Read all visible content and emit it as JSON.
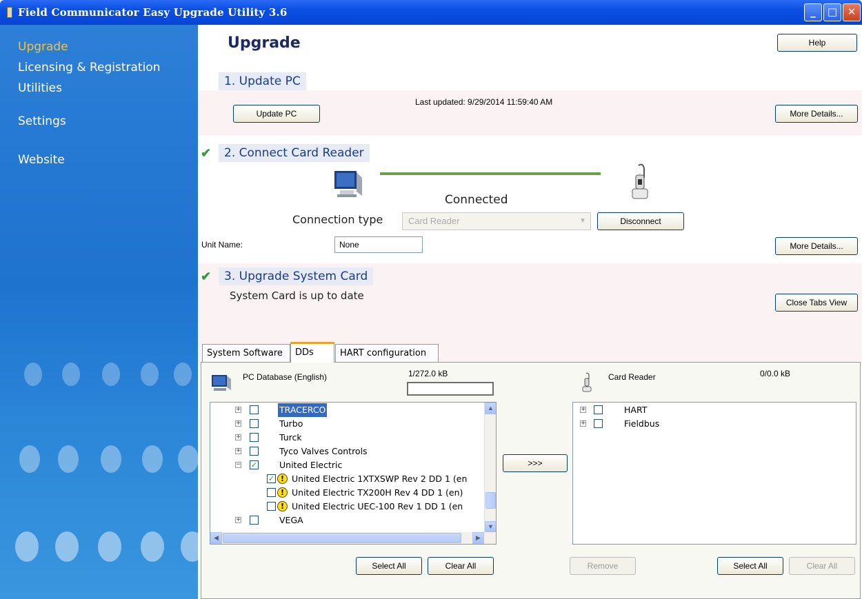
{
  "window": {
    "title": "Field Communicator Easy Upgrade Utility 3.6",
    "controls": {
      "minimize": "_",
      "maximize": "□",
      "close": "✕"
    }
  },
  "sidebar": {
    "items": [
      {
        "label": "Upgrade",
        "active": true
      },
      {
        "label": "Licensing & Registration"
      },
      {
        "label": "Utilities"
      },
      {
        "label": "Settings"
      },
      {
        "label": "Website"
      }
    ]
  },
  "header": {
    "title": "Upgrade",
    "help_label": "Help"
  },
  "section1": {
    "title": "1. Update PC",
    "update_button": "Update PC",
    "last_updated": "Last updated: 9/29/2014 11:59:40 AM",
    "more_details": "More Details..."
  },
  "section2": {
    "title": "2. Connect Card Reader",
    "check_icon": "✔",
    "status": "Connected",
    "connection_type_label": "Connection type",
    "connection_type_value": "Card Reader",
    "disconnect_button": "Disconnect",
    "unit_name_label": "Unit Name:",
    "unit_name_value": "None",
    "more_details": "More Details..."
  },
  "section3": {
    "title": "3. Upgrade System Card",
    "check_icon": "✔",
    "status": "System Card is up to date",
    "close_tabs_button": "Close Tabs View"
  },
  "tabs": [
    {
      "label": "System Software"
    },
    {
      "label": "DDs",
      "active": true
    },
    {
      "label": "HART configuration"
    }
  ],
  "pc_database": {
    "label": "PC Database (English)",
    "size": "1/272.0 kB",
    "progress_fraction": 0,
    "items": [
      {
        "label": "TRACERCO",
        "checked": false,
        "expander": "+",
        "selected": true
      },
      {
        "label": "Turbo",
        "checked": false,
        "expander": "+"
      },
      {
        "label": "Turck",
        "checked": false,
        "expander": "+"
      },
      {
        "label": "Tyco Valves Controls",
        "checked": false,
        "expander": "+"
      },
      {
        "label": "United Electric",
        "checked": true,
        "expander": "−"
      },
      {
        "label": "United Electric 1XTXSWP Rev 2 DD 1 (en",
        "checked": true,
        "child": true,
        "warning": "!"
      },
      {
        "label": "United Electric TX200H Rev 4 DD 1 (en)",
        "checked": false,
        "child": true,
        "warning": "!"
      },
      {
        "label": "United Electric UEC-100 Rev 1 DD 1 (en",
        "checked": false,
        "child": true,
        "warning": "!"
      },
      {
        "label": "VEGA",
        "checked": false,
        "expander": "+"
      }
    ]
  },
  "card_reader": {
    "label": "Card Reader",
    "size": "0/0.0 kB",
    "items": [
      {
        "label": "HART",
        "expander": "+"
      },
      {
        "label": "Fieldbus",
        "expander": "+"
      }
    ]
  },
  "buttons": {
    "transfer": ">>>",
    "select_all": "Select All",
    "clear_all": "Clear All",
    "remove": "Remove"
  },
  "scroll": {
    "up": "▲",
    "down": "▼",
    "left": "◀",
    "right": "▶",
    "dropdown": "▼"
  }
}
